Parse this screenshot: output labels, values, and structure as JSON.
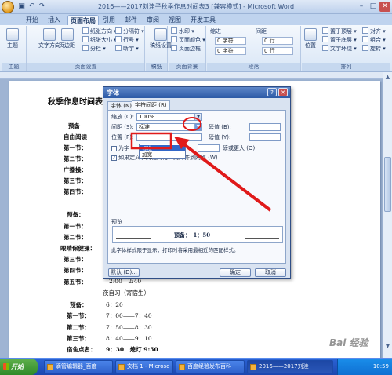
{
  "window": {
    "title": "2016——2017刘洼子秋季作息时间表3 [兼容模式] - Microsoft Word",
    "min": "–",
    "max": "□",
    "close": "✕"
  },
  "ribbon_tabs": [
    "开始",
    "插入",
    "页面布局",
    "引用",
    "邮件",
    "审阅",
    "视图",
    "开发工具"
  ],
  "ribbon": {
    "themes": {
      "label": "主题",
      "btn": "主题"
    },
    "page_setup": {
      "label": "页面设置",
      "big": [
        "文字方向",
        "页边距",
        "纸张方向",
        "纸张大小",
        "分栏"
      ],
      "small": [
        "纸张方向 ▾",
        "纸张大小 ▾",
        "分栏 ▾",
        "分隔符 ▾",
        "行号 ▾",
        "断字 ▾"
      ]
    },
    "draft": {
      "label": "稿纸",
      "btn": "稿纸设置"
    },
    "page_bg": {
      "label": "页面背景",
      "small": [
        "水印 ▾",
        "页面颜色 ▾",
        "页面边框"
      ]
    },
    "paragraph": {
      "label": "段落",
      "indent": "缩进",
      "spacing": "间距",
      "indent_left": "0 字符",
      "indent_right": "0 字符",
      "space_before": "0 行",
      "space_after": "0 行"
    },
    "arrange": {
      "label": "排列",
      "big": "位置",
      "small": [
        "置于顶层 ▾",
        "置于底层 ▾",
        "文字环绕 ▾",
        "对齐 ▾",
        "组合 ▾",
        "旋转 ▾"
      ]
    }
  },
  "document": {
    "heading": "秋季作息时间表",
    "rows_left": [
      "预备",
      "自由阅读",
      "第一节：",
      "第二节：",
      "广播操：",
      "第三节：",
      "第四节："
    ],
    "rows_left2": [
      "预备：",
      "第一节：",
      "第二节：",
      "眼睛保健操：",
      "第三节：",
      "第四节：",
      "第五节："
    ],
    "fifth_time": "2:00—2:40",
    "evening_title": "夜自习（寄宿生）",
    "evening_rows": [
      {
        "label": "预备：",
        "time": "6：20"
      },
      {
        "label": "第一节：",
        "time": "7：00——7：40"
      },
      {
        "label": "第二节：",
        "time": "7：50——8：30"
      },
      {
        "label": "第三节：",
        "time": "8：40——9：10"
      },
      {
        "label": "宿舍点名：",
        "time": "9：30　熄灯 9:50"
      }
    ]
  },
  "dialog": {
    "title": "字体",
    "help": "?",
    "close": "✕",
    "tabs": [
      "字体 (N)",
      "字符间距 (R)"
    ],
    "scale_label": "缩放 (C):",
    "scale_value": "100%",
    "spacing_label": "间距 (S):",
    "spacing_value": "标准",
    "spacing_by_label": "磅值 (B):",
    "position_label": "位置 (P):",
    "position_by_label": "磅值 (Y):",
    "dropdown_options": [
      "标准",
      "加宽",
      "紧缩"
    ],
    "kerning_label": "为字",
    "kerning_suffix": "磅或更大 (O)",
    "grid_label": "如果定义了文档网格，则对齐到网格 (W)",
    "preview_title": "预览",
    "preview_text": "预备：　1：50",
    "preview_note": "此字体样式限于显示，打印时将采用最相近的匹配样式。",
    "default_btn": "默认 (D)...",
    "ok_btn": "确定",
    "cancel_btn": "取消"
  },
  "taskbar": {
    "start": "开始",
    "tasks": [
      "滴管编辑器_百度",
      "文档 1 - Microso",
      "百度经验发布百科",
      "2016——2017刘洼"
    ],
    "time": "10:59"
  },
  "watermark": "Bai 经验"
}
